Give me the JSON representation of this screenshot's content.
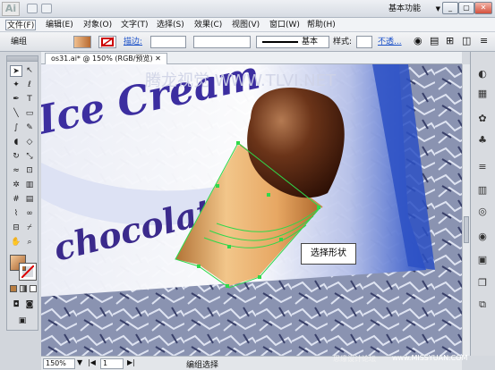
{
  "app": {
    "logo": "Ai",
    "workspace": "基本功能"
  },
  "menu": [
    "文件(F)",
    "编辑(E)",
    "对象(O)",
    "文字(T)",
    "选择(S)",
    "效果(C)",
    "视图(V)",
    "窗口(W)",
    "帮助(H)"
  ],
  "control": {
    "selection_label": "编组",
    "stroke_link": "描边:",
    "profile_label": "基本",
    "style_label": "样式:",
    "opacity_link": "不透..."
  },
  "document": {
    "tab": "os31.ai* @ 150% (RGB/预览)"
  },
  "artwork": {
    "brand_line": "Ice Cream",
    "flavor_line": "chocolate",
    "watermark_top": "腾龙视觉 WWW.TLVI.NET"
  },
  "callout": {
    "text": "选择形状"
  },
  "status": {
    "zoom": "150%",
    "artboard": "1",
    "tool_status": "编组选择"
  },
  "footer_watermark": {
    "left": "思缘设计论坛",
    "right": "www.MISSYUAN.COM"
  },
  "colors": {
    "cone": "#e2a968",
    "chocolate": "#5a2a14",
    "path_green": "#2fd84a"
  },
  "toolbox_icons": [
    "selection-icon",
    "direct-selection-icon",
    "magic-wand-icon",
    "lasso-icon",
    "pen-icon",
    "type-icon",
    "line-icon",
    "rectangle-icon",
    "brush-icon",
    "pencil-icon",
    "blob-brush-icon",
    "eraser-icon",
    "rotate-icon",
    "scale-icon",
    "warp-icon",
    "free-transform-icon",
    "symbol-sprayer-icon",
    "graph-icon",
    "mesh-icon",
    "gradient-icon",
    "eyedropper-icon",
    "blend-icon",
    "artboard-icon",
    "slice-icon",
    "hand-icon",
    "zoom-icon"
  ],
  "panel_icons": [
    "color-icon",
    "swatches-icon",
    "brushes-icon",
    "symbols-icon",
    "stroke-icon",
    "gradient-panel-icon",
    "transparency-icon",
    "appearance-icon",
    "graphic-styles-icon",
    "layers-icon"
  ]
}
